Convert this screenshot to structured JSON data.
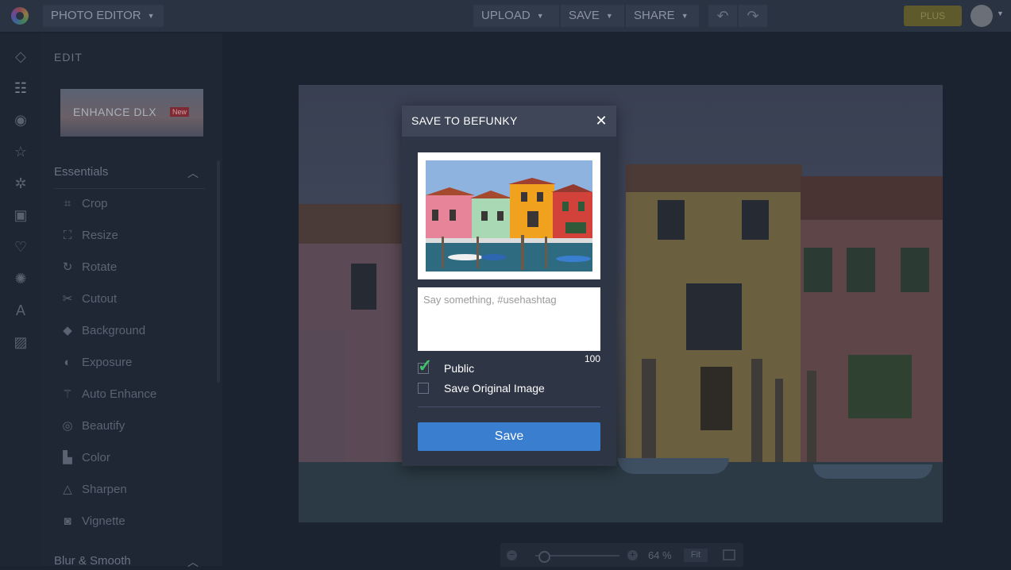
{
  "topbar": {
    "app_menu_label": "PHOTO EDITOR",
    "upload_label": "UPLOAD",
    "save_label": "SAVE",
    "share_label": "SHARE",
    "upgrade_label": "PLUS"
  },
  "panel": {
    "title": "EDIT",
    "enhance_card": {
      "label": "ENHANCE DLX",
      "badge": "New"
    },
    "essentials_header": "Essentials",
    "tools": [
      {
        "label": "Crop",
        "icon": "crop-icon"
      },
      {
        "label": "Resize",
        "icon": "resize-icon"
      },
      {
        "label": "Rotate",
        "icon": "rotate-icon"
      },
      {
        "label": "Cutout",
        "icon": "scissors-icon"
      },
      {
        "label": "Background",
        "icon": "eraser-icon"
      },
      {
        "label": "Exposure",
        "icon": "exposure-icon"
      },
      {
        "label": "Auto Enhance",
        "icon": "magic-wand-icon"
      },
      {
        "label": "Beautify",
        "icon": "beautify-icon"
      },
      {
        "label": "Color",
        "icon": "paint-bucket-icon"
      },
      {
        "label": "Sharpen",
        "icon": "triangle-icon"
      },
      {
        "label": "Vignette",
        "icon": "vignette-icon"
      }
    ],
    "blur_header": "Blur & Smooth"
  },
  "zoom": {
    "value": "64 %",
    "fit_label": "Fit"
  },
  "modal": {
    "title": "SAVE TO BEFUNKY",
    "caption_placeholder": "Say something, #usehashtag",
    "char_count": "100",
    "public_label": "Public",
    "public_checked": true,
    "save_original_label": "Save Original Image",
    "save_original_checked": false,
    "save_button_label": "Save"
  },
  "colors": {
    "accent": "#3a7ed0",
    "check": "#3fc26a",
    "modal_bg": "#2e3646",
    "modal_header": "#3e4658"
  }
}
